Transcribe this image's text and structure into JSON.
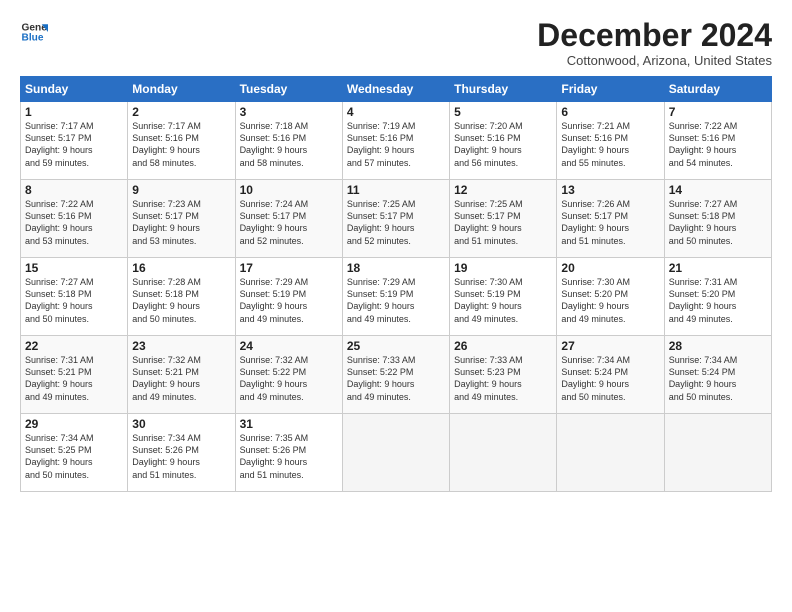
{
  "logo": {
    "line1": "General",
    "line2": "Blue"
  },
  "title": "December 2024",
  "subtitle": "Cottonwood, Arizona, United States",
  "headers": [
    "Sunday",
    "Monday",
    "Tuesday",
    "Wednesday",
    "Thursday",
    "Friday",
    "Saturday"
  ],
  "weeks": [
    [
      {
        "day": "1",
        "info": "Sunrise: 7:17 AM\nSunset: 5:17 PM\nDaylight: 9 hours\nand 59 minutes."
      },
      {
        "day": "2",
        "info": "Sunrise: 7:17 AM\nSunset: 5:16 PM\nDaylight: 9 hours\nand 58 minutes."
      },
      {
        "day": "3",
        "info": "Sunrise: 7:18 AM\nSunset: 5:16 PM\nDaylight: 9 hours\nand 58 minutes."
      },
      {
        "day": "4",
        "info": "Sunrise: 7:19 AM\nSunset: 5:16 PM\nDaylight: 9 hours\nand 57 minutes."
      },
      {
        "day": "5",
        "info": "Sunrise: 7:20 AM\nSunset: 5:16 PM\nDaylight: 9 hours\nand 56 minutes."
      },
      {
        "day": "6",
        "info": "Sunrise: 7:21 AM\nSunset: 5:16 PM\nDaylight: 9 hours\nand 55 minutes."
      },
      {
        "day": "7",
        "info": "Sunrise: 7:22 AM\nSunset: 5:16 PM\nDaylight: 9 hours\nand 54 minutes."
      }
    ],
    [
      {
        "day": "8",
        "info": "Sunrise: 7:22 AM\nSunset: 5:16 PM\nDaylight: 9 hours\nand 53 minutes."
      },
      {
        "day": "9",
        "info": "Sunrise: 7:23 AM\nSunset: 5:17 PM\nDaylight: 9 hours\nand 53 minutes."
      },
      {
        "day": "10",
        "info": "Sunrise: 7:24 AM\nSunset: 5:17 PM\nDaylight: 9 hours\nand 52 minutes."
      },
      {
        "day": "11",
        "info": "Sunrise: 7:25 AM\nSunset: 5:17 PM\nDaylight: 9 hours\nand 52 minutes."
      },
      {
        "day": "12",
        "info": "Sunrise: 7:25 AM\nSunset: 5:17 PM\nDaylight: 9 hours\nand 51 minutes."
      },
      {
        "day": "13",
        "info": "Sunrise: 7:26 AM\nSunset: 5:17 PM\nDaylight: 9 hours\nand 51 minutes."
      },
      {
        "day": "14",
        "info": "Sunrise: 7:27 AM\nSunset: 5:18 PM\nDaylight: 9 hours\nand 50 minutes."
      }
    ],
    [
      {
        "day": "15",
        "info": "Sunrise: 7:27 AM\nSunset: 5:18 PM\nDaylight: 9 hours\nand 50 minutes."
      },
      {
        "day": "16",
        "info": "Sunrise: 7:28 AM\nSunset: 5:18 PM\nDaylight: 9 hours\nand 50 minutes."
      },
      {
        "day": "17",
        "info": "Sunrise: 7:29 AM\nSunset: 5:19 PM\nDaylight: 9 hours\nand 49 minutes."
      },
      {
        "day": "18",
        "info": "Sunrise: 7:29 AM\nSunset: 5:19 PM\nDaylight: 9 hours\nand 49 minutes."
      },
      {
        "day": "19",
        "info": "Sunrise: 7:30 AM\nSunset: 5:19 PM\nDaylight: 9 hours\nand 49 minutes."
      },
      {
        "day": "20",
        "info": "Sunrise: 7:30 AM\nSunset: 5:20 PM\nDaylight: 9 hours\nand 49 minutes."
      },
      {
        "day": "21",
        "info": "Sunrise: 7:31 AM\nSunset: 5:20 PM\nDaylight: 9 hours\nand 49 minutes."
      }
    ],
    [
      {
        "day": "22",
        "info": "Sunrise: 7:31 AM\nSunset: 5:21 PM\nDaylight: 9 hours\nand 49 minutes."
      },
      {
        "day": "23",
        "info": "Sunrise: 7:32 AM\nSunset: 5:21 PM\nDaylight: 9 hours\nand 49 minutes."
      },
      {
        "day": "24",
        "info": "Sunrise: 7:32 AM\nSunset: 5:22 PM\nDaylight: 9 hours\nand 49 minutes."
      },
      {
        "day": "25",
        "info": "Sunrise: 7:33 AM\nSunset: 5:22 PM\nDaylight: 9 hours\nand 49 minutes."
      },
      {
        "day": "26",
        "info": "Sunrise: 7:33 AM\nSunset: 5:23 PM\nDaylight: 9 hours\nand 49 minutes."
      },
      {
        "day": "27",
        "info": "Sunrise: 7:34 AM\nSunset: 5:24 PM\nDaylight: 9 hours\nand 50 minutes."
      },
      {
        "day": "28",
        "info": "Sunrise: 7:34 AM\nSunset: 5:24 PM\nDaylight: 9 hours\nand 50 minutes."
      }
    ],
    [
      {
        "day": "29",
        "info": "Sunrise: 7:34 AM\nSunset: 5:25 PM\nDaylight: 9 hours\nand 50 minutes."
      },
      {
        "day": "30",
        "info": "Sunrise: 7:34 AM\nSunset: 5:26 PM\nDaylight: 9 hours\nand 51 minutes."
      },
      {
        "day": "31",
        "info": "Sunrise: 7:35 AM\nSunset: 5:26 PM\nDaylight: 9 hours\nand 51 minutes."
      },
      {
        "day": "",
        "info": ""
      },
      {
        "day": "",
        "info": ""
      },
      {
        "day": "",
        "info": ""
      },
      {
        "day": "",
        "info": ""
      }
    ]
  ]
}
